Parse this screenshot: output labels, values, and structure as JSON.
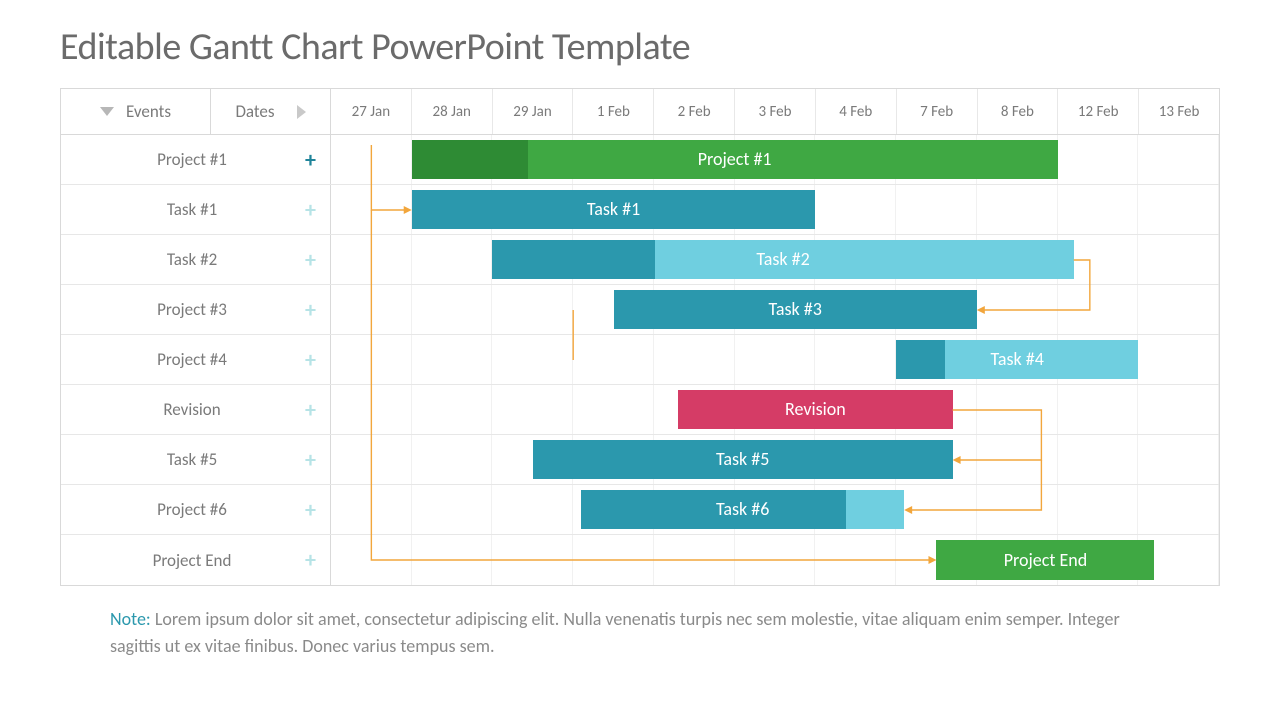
{
  "title": "Editable Gantt Chart PowerPoint Template",
  "columns": {
    "events": "Events",
    "dates": "Dates"
  },
  "dateLabels": [
    "27 Jan",
    "28 Jan",
    "29 Jan",
    "1 Feb",
    "2 Feb",
    "3 Feb",
    "4 Feb",
    "7 Feb",
    "8 Feb",
    "12 Feb",
    "13 Feb"
  ],
  "rows": [
    {
      "label": "Project #1",
      "expand": true
    },
    {
      "label": "Task #1",
      "expand": false
    },
    {
      "label": "Task #2",
      "expand": false
    },
    {
      "label": "Project #3",
      "expand": false
    },
    {
      "label": "Project #4",
      "expand": false
    },
    {
      "label": "Revision",
      "expand": false
    },
    {
      "label": "Task #5",
      "expand": false
    },
    {
      "label": "Project #6",
      "expand": false
    },
    {
      "label": "Project End",
      "expand": false
    }
  ],
  "note": {
    "label": "Note:",
    "text": "Lorem ipsum dolor sit amet, consectetur adipiscing elit. Nulla venenatis turpis nec sem molestie, vitae aliquam enim semper. Integer sagittis ut ex vitae finibus. Donec varius tempus sem."
  },
  "colors": {
    "green": "#3fa843",
    "greenDark": "#2e8b34",
    "teal": "#2b98ad",
    "tealLight": "#6fcfe0",
    "sky": "#6fcfe0",
    "pink": "#d53c66",
    "green2": "#3fa843",
    "connector": "#f2a63c"
  },
  "chart_data": {
    "type": "bar",
    "title": "Editable Gantt Chart PowerPoint Template",
    "xlabel": "Dates",
    "ylabel": "Events",
    "categories": [
      "27 Jan",
      "28 Jan",
      "29 Jan",
      "1 Feb",
      "2 Feb",
      "3 Feb",
      "4 Feb",
      "7 Feb",
      "8 Feb",
      "12 Feb",
      "13 Feb"
    ],
    "series": [
      {
        "name": "Project #1",
        "row": 0,
        "start": 1,
        "end": 9,
        "progress": 0.18,
        "fill": "green",
        "progressFill": "greenDark"
      },
      {
        "name": "Task #1",
        "row": 1,
        "start": 1,
        "end": 6,
        "progress": 0.0,
        "fill": "teal"
      },
      {
        "name": "Task #2",
        "row": 2,
        "start": 2,
        "end": 9.2,
        "progress": 0.28,
        "fill": "sky",
        "progressFill": "teal"
      },
      {
        "name": "Task #3",
        "row": 3,
        "start": 3.5,
        "end": 8,
        "progress": 0.0,
        "fill": "teal"
      },
      {
        "name": "Task #4",
        "row": 4,
        "start": 7,
        "end": 10,
        "progress": 0.2,
        "fill": "sky",
        "progressFill": "teal"
      },
      {
        "name": "Revision",
        "row": 5,
        "start": 4.3,
        "end": 7.7,
        "progress": 0.0,
        "fill": "pink"
      },
      {
        "name": "Task #5",
        "row": 6,
        "start": 2.5,
        "end": 7.7,
        "progress": 0.0,
        "fill": "teal"
      },
      {
        "name": "Task #6",
        "row": 7,
        "start": 3.1,
        "end": 7.1,
        "progress": 0.82,
        "fill": "sky",
        "progressFill": "teal"
      },
      {
        "name": "Project End",
        "row": 8,
        "start": 7.5,
        "end": 10.2,
        "progress": 0.0,
        "fill": "green2"
      }
    ],
    "connectors": [
      {
        "fromRow": 0,
        "fromX": 0.5,
        "toRow": 1,
        "toX": 1,
        "arrow": "right"
      },
      {
        "fromRow": 2,
        "fromX": 9.2,
        "side": "right-down-left",
        "toRow": 3,
        "toX": 8,
        "arrow": "left"
      },
      {
        "fromRow": 3,
        "fromX": 3.0,
        "side": "down-right",
        "toRow": 4,
        "toX": 7,
        "arrow": "right-hidden"
      },
      {
        "fromRow": 5,
        "fromX": 7.7,
        "side": "right-down-left-long",
        "toRow": 7,
        "toX": 7.1,
        "via": 8.8,
        "arrow": "left"
      },
      {
        "fromRow": 5,
        "fromX": 7.7,
        "side": "right-down-left-short",
        "toRow": 6,
        "toX": 7.7,
        "via": 8.8,
        "arrow": "left"
      },
      {
        "fromRow": 0,
        "fromX": 0.5,
        "side": "long-down",
        "toRow": 8,
        "toX": 7.5,
        "arrow": "right"
      }
    ]
  }
}
